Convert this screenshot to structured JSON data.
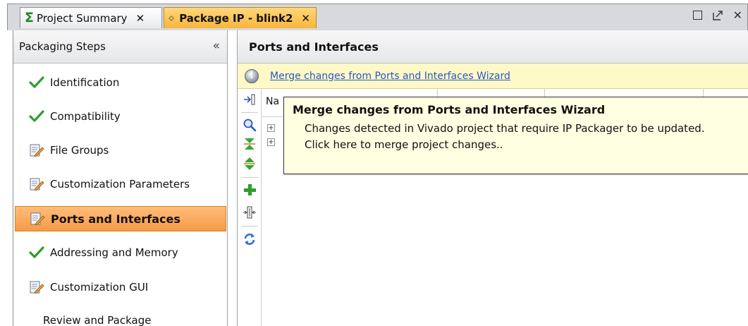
{
  "tabs": [
    {
      "label": "Project Summary",
      "close": "✕",
      "icon": "sigma-icon"
    },
    {
      "label": "Package IP - blink2",
      "close": "✕",
      "icon": "package-icon"
    }
  ],
  "window_controls": {
    "maximize": "maximize-icon",
    "float": "float-icon",
    "close": "✕"
  },
  "left_panel": {
    "title": "Packaging Steps",
    "collapse_glyph": "«",
    "steps": [
      {
        "label": "Identification",
        "status": "done"
      },
      {
        "label": "Compatibility",
        "status": "done"
      },
      {
        "label": "File Groups",
        "status": "edited"
      },
      {
        "label": "Customization Parameters",
        "status": "edited"
      },
      {
        "label": "Ports and Interfaces",
        "status": "edited-current"
      },
      {
        "label": "Addressing and Memory",
        "status": "done"
      },
      {
        "label": "Customization GUI",
        "status": "edited"
      },
      {
        "label": "Review and Package",
        "status": "none"
      }
    ]
  },
  "right_panel": {
    "title": "Ports and Interfaces",
    "banner": {
      "icon": "info-icon",
      "glyph": "!",
      "link_text": "Merge changes from Ports and Interfaces Wizard"
    },
    "column_header_first": "Na",
    "toolbar_icons": [
      "expand-icon",
      "search-icon",
      "collapse-all-icon",
      "expand-all-icon",
      "add-icon",
      "split-icon",
      "refresh-icon"
    ]
  },
  "tooltip": {
    "title": "Merge changes from Ports and Interfaces Wizard",
    "line1": "Changes detected in Vivado project that require IP Packager to be updated.",
    "line2": "Click here to merge project changes.."
  },
  "colors": {
    "active_tab": "#f9b53c",
    "current_step": "#f69a45",
    "check_green": "#2e9e2e",
    "banner_bg": "#fff9c7",
    "tooltip_bg": "#ffffe1",
    "link": "#2a56c6"
  }
}
